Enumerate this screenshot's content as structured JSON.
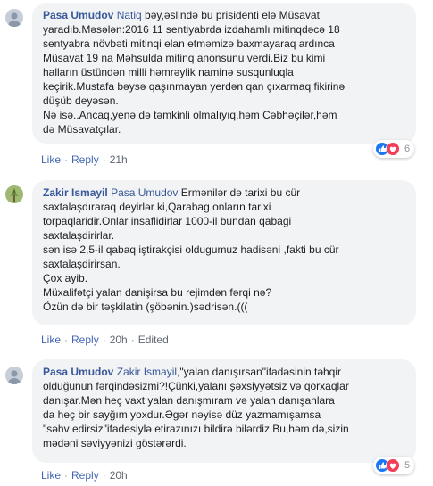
{
  "comments": [
    {
      "author": "Pasa Umudov",
      "tag": "Natiq",
      "lines": [
        " bəy,əslində bu prisidenti elə Müsavat",
        "yaradıb.Məsələn:2016 11 sentiyabrda izdahamlı mitinqdəcə 18",
        "sentyabra növbəti mitinqi elan etməmizə baxmayaraq ardınca",
        "Müsavat 19 na Məhsulda mitinq anonsunu verdi.Biz bu kimi",
        "halların üstündən milli həmrəylik naminə susqunluqla",
        "keçirik.Mustafa bəysə qaşınmayan yerdən qan çıxarmaq fikirinə",
        "düşüb deyəsən.",
        "Nə isə..Ancaq,yenə də təmkinli olmalıyıq,həm Cəbhəçilər,həm",
        "də Müsavatçılar."
      ],
      "actions": {
        "like": "Like",
        "reply": "Reply",
        "time": "21h",
        "edited": ""
      },
      "reactions": {
        "count": "6",
        "icons": [
          "like-reaction-icon",
          "love-reaction-icon"
        ]
      }
    },
    {
      "author": "Zakir Ismayil",
      "tag": "Pasa Umudov",
      "lines": [
        " Ermənilər də tarixi bu cür",
        "saxtalaşdıraraq deyirlər ki,Qarabag onların tarixi",
        "torpaqlaridir.Onlar insaflidirlar 1000-il bundan qabagi",
        "saxtalaşdirirlar.",
        "sən isə 2,5-il qabaq iştirakçisi oldugumuz hadisəni ,fakti bu cür",
        "saxtalaşdirirsan.",
        "Çox ayib.",
        "Müxalifətçi yalan danişirsa bu rejimdən fərqi nə?",
        "Özün də bir təşkilatin (şöbənin.)sədrisən.((("
      ],
      "actions": {
        "like": "Like",
        "reply": "Reply",
        "time": "20h",
        "edited": "Edited"
      }
    },
    {
      "author": "Pasa Umudov",
      "tag": "Zakir Ismayil",
      "lines": [
        ",\"yalan danışırsan\"ifadəsinin təhqir",
        "olduğunun fərqindəsizmi?!Çünki,yalanı şəxsiyyətsiz və qorxaqlar",
        "danışar.Mən heç vaxt yalan danışmıram və yalan danışanlara",
        "da heç bir sayğım yoxdur.Əgər nəyisə düz yazmamışamsa",
        "\"səhv edirsiz\"ifadesiylə etirazınızı bildirə bilərdiz.Bu,həm də,sizin",
        "mədəni səviyyənizi göstərərdi."
      ],
      "actions": {
        "like": "Like",
        "reply": "Reply",
        "time": "20h",
        "edited": ""
      },
      "reactions": {
        "count": "5",
        "icons": [
          "like-reaction-icon",
          "love-reaction-icon"
        ]
      }
    }
  ],
  "colors": {
    "link": "#385898",
    "action_link": "#4267b2",
    "bubble": "#f2f3f5",
    "meta": "#90949c",
    "like_blue": "#1877f2",
    "love_red": "#f33e58"
  }
}
